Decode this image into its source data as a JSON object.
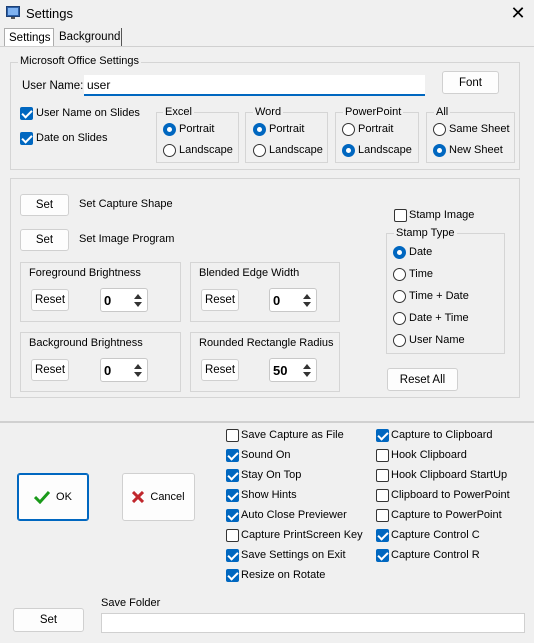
{
  "window": {
    "title": "Settings",
    "close_glyph": "✕"
  },
  "tabs": [
    "Settings",
    "Background"
  ],
  "office": {
    "group_label": "Microsoft Office Settings",
    "user_name_label": "User Name:",
    "user_name_value": "user",
    "font_button": "Font",
    "user_name_on_slides": {
      "label": "User Name on Slides",
      "checked": true
    },
    "date_on_slides": {
      "label": "Date on Slides",
      "checked": true
    },
    "excel": {
      "label": "Excel",
      "options": [
        "Portrait",
        "Landscape"
      ],
      "selected": "Portrait"
    },
    "word": {
      "label": "Word",
      "options": [
        "Portrait",
        "Landscape"
      ],
      "selected": "Portrait"
    },
    "powerpoint": {
      "label": "PowerPoint",
      "options": [
        "Portrait",
        "Landscape"
      ],
      "selected": "Landscape"
    },
    "all": {
      "label": "All",
      "options": [
        "Same Sheet",
        "New Sheet"
      ],
      "selected": "New Sheet"
    }
  },
  "capture": {
    "set_button": "Set",
    "set_capture_shape": "Set Capture Shape",
    "set_image_program": "Set Image Program",
    "reset_button": "Reset",
    "foreground_brightness": {
      "label": "Foreground Brightness",
      "value": "0"
    },
    "blended_edge_width": {
      "label": "Blended Edge Width",
      "value": "0"
    },
    "background_brightness": {
      "label": "Background Brightness",
      "value": "0"
    },
    "rounded_rectangle_radius": {
      "label": "Rounded Rectangle Radius",
      "value": "50"
    },
    "stamp_image": {
      "label": "Stamp Image",
      "checked": false
    },
    "stamp_type": {
      "label": "Stamp Type",
      "options": [
        "Date",
        "Time",
        "Time + Date",
        "Date + Time",
        "User Name"
      ],
      "selected": "Date"
    },
    "reset_all_button": "Reset All"
  },
  "bottom": {
    "ok_button": "OK",
    "cancel_button": "Cancel",
    "options_left": [
      {
        "label": "Save Capture as File",
        "checked": false
      },
      {
        "label": "Sound On",
        "checked": true
      },
      {
        "label": "Stay On Top",
        "checked": true
      },
      {
        "label": "Show Hints",
        "checked": true
      },
      {
        "label": "Auto Close Previewer",
        "checked": true
      },
      {
        "label": "Capture PrintScreen Key",
        "checked": false
      },
      {
        "label": "Save Settings on Exit",
        "checked": true
      },
      {
        "label": "Resize on Rotate",
        "checked": true
      }
    ],
    "options_right": [
      {
        "label": "Capture to Clipboard",
        "checked": true
      },
      {
        "label": "Hook Clipboard",
        "checked": false
      },
      {
        "label": "Hook Clipboard StartUp",
        "checked": false
      },
      {
        "label": "Clipboard to PowerPoint",
        "checked": false
      },
      {
        "label": "Capture to PowerPoint",
        "checked": false
      },
      {
        "label": "Capture Control C",
        "checked": true
      },
      {
        "label": "Capture Control R",
        "checked": true
      }
    ],
    "save_folder_label": "Save Folder",
    "save_folder_value": "",
    "set_button": "Set"
  },
  "colors": {
    "accent": "#0067c0",
    "ok_check": "#1a9a1a",
    "cancel_x": "#c0272d"
  }
}
